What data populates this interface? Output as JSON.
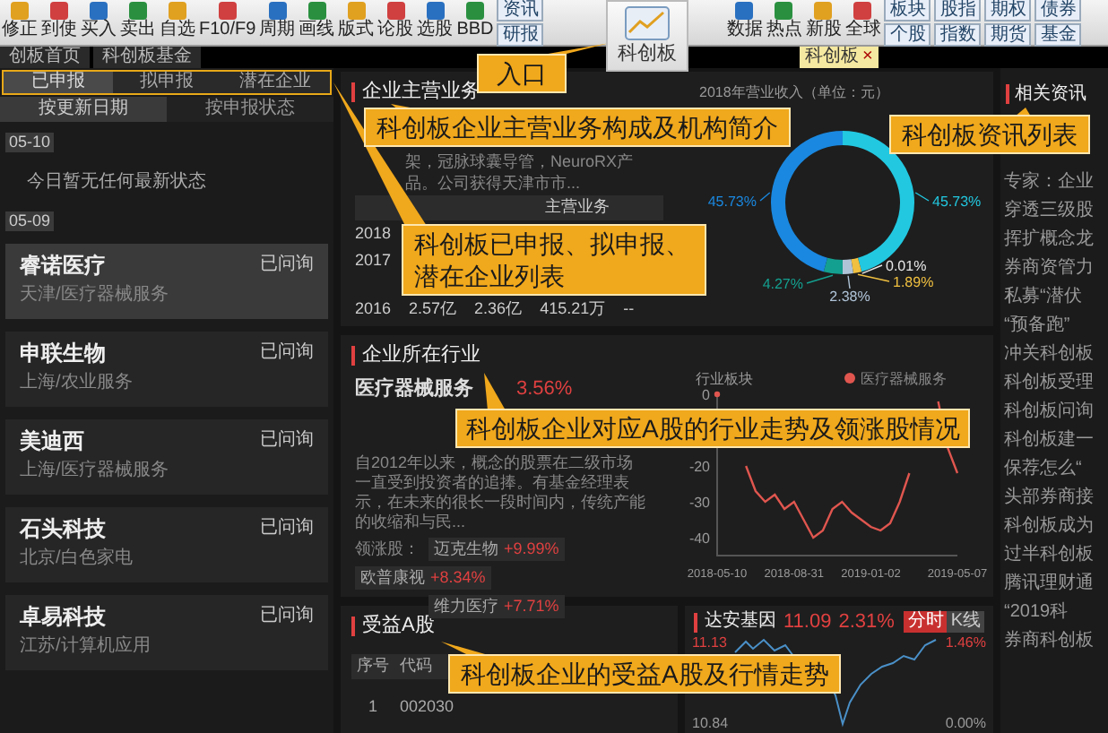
{
  "toolbar": {
    "items": [
      {
        "kind": "tool",
        "label": "修正"
      },
      {
        "kind": "tool",
        "label": "到使"
      },
      {
        "kind": "tool",
        "label": "买入"
      },
      {
        "kind": "tool",
        "label": "卖出"
      },
      {
        "kind": "tool",
        "label": "自选"
      },
      {
        "kind": "tool",
        "label": "F10/F9"
      },
      {
        "kind": "tool",
        "label": "周期"
      },
      {
        "kind": "tool",
        "label": "画线"
      },
      {
        "kind": "tool",
        "label": "版式"
      },
      {
        "kind": "tool",
        "label": "论股"
      },
      {
        "kind": "tool",
        "label": "选股"
      },
      {
        "kind": "tool",
        "label": "BBD"
      },
      {
        "kind": "pair",
        "labels": [
          "资讯",
          "研报"
        ]
      },
      {
        "kind": "gap"
      },
      {
        "kind": "tool",
        "label": "数据"
      },
      {
        "kind": "tool",
        "label": "热点"
      },
      {
        "kind": "tool",
        "label": "新股"
      },
      {
        "kind": "tool",
        "label": "全球"
      },
      {
        "kind": "pair",
        "labels": [
          "板块",
          "个股"
        ]
      },
      {
        "kind": "pair",
        "labels": [
          "股指",
          "指数"
        ]
      },
      {
        "kind": "pair",
        "labels": [
          "期权",
          "期货"
        ]
      },
      {
        "kind": "pair",
        "labels": [
          "债券",
          "基金"
        ]
      }
    ]
  },
  "entry_icon": {
    "label": "科创板"
  },
  "tabs": [
    {
      "label": "创板首页",
      "selected": false
    },
    {
      "label": "科创板基金",
      "selected": false
    }
  ],
  "open_tab": {
    "label": "科创板",
    "close": "×"
  },
  "left": {
    "segments": [
      {
        "label": "已申报",
        "selected": true
      },
      {
        "label": "拟申报",
        "selected": false
      },
      {
        "label": "潜在企业",
        "selected": false
      }
    ],
    "sort_tabs": [
      {
        "label": "按更新日期",
        "selected": true
      },
      {
        "label": "按申报状态",
        "selected": false
      }
    ],
    "groups": [
      {
        "date": "05-10",
        "message": "今日暂无任何最新状态"
      },
      {
        "date": "05-09",
        "companies": [
          {
            "name": "睿诺医疗",
            "info": "天津/医疗器械服务",
            "status": "已问询",
            "selected": true
          },
          {
            "name": "申联生物",
            "info": "上海/农业服务",
            "status": "已问询",
            "selected": false
          },
          {
            "name": "美迪西",
            "info": "上海/医疗器械服务",
            "status": "已问询",
            "selected": false
          },
          {
            "name": "石头科技",
            "info": "北京/白色家电",
            "status": "已问询",
            "selected": false
          },
          {
            "name": "卓易科技",
            "info": "江苏/计算机应用",
            "status": "已问询",
            "selected": false
          }
        ]
      }
    ]
  },
  "business": {
    "title": "企业主营业务",
    "description": "架，冠脉球囊导管，NeuroRX产品。公司获得天津市市...",
    "table": {
      "header": "主营业务",
      "rows": [
        [
          "2018"
        ],
        [
          "2017"
        ],
        [
          "2016",
          "2.57亿",
          "2.36亿",
          "415.21万",
          "--"
        ]
      ]
    },
    "chart_data": {
      "type": "donut",
      "title": "2018年营业收入（单位：元）",
      "values": [
        45.73,
        0.01,
        1.89,
        2.38,
        4.27,
        45.73
      ],
      "value_labels": [
        "45.73%",
        "0.01%",
        "1.89%",
        "2.38%",
        "4.27%",
        "45.73%"
      ]
    }
  },
  "industry": {
    "title": "企业所在行业",
    "name": "医疗器械服务",
    "change": "3.56%",
    "description": "自2012年以来，概念的股票在二级市场一直受到投资者的追捧。有基金经理表示，在未来的很长一段时间内，传统产能的收缩和与民...",
    "leaders_label": "领涨股：",
    "leaders": [
      {
        "name": "迈克生物",
        "change": "+9.99%"
      },
      {
        "name": "欧普康视",
        "change": "+8.34%"
      },
      {
        "name": "维力医疗",
        "change": "+7.71%"
      }
    ],
    "chart_data": {
      "type": "line",
      "title": "行业板块",
      "series": [
        {
          "name": "医疗器械服务",
          "color": "#e0564f",
          "values": [
            0,
            null,
            null,
            -20,
            -27,
            -30,
            -28,
            -32,
            -30,
            -35,
            -40,
            -38,
            -32,
            -30,
            -33,
            -35,
            -37,
            -38,
            -36,
            -30,
            -22,
            null,
            null,
            -2,
            -15,
            -22
          ]
        }
      ],
      "categories": [
        "2018-05-10",
        null,
        null,
        null,
        null,
        null,
        null,
        null,
        "2018-08-31",
        null,
        null,
        null,
        null,
        null,
        null,
        null,
        "2019-01-02",
        null,
        null,
        null,
        null,
        null,
        null,
        null,
        null,
        "2019-05-07"
      ],
      "ylim": [
        -45,
        0
      ],
      "yticks": [
        0,
        -20,
        -30,
        -40
      ]
    }
  },
  "benefit": {
    "title": "受益A股",
    "columns": [
      "序号",
      "代码"
    ],
    "rows": [
      [
        "1",
        "002030"
      ]
    ]
  },
  "quote": {
    "name": "达安基因",
    "price": "11.09",
    "change": "2.31%",
    "modes": [
      {
        "label": "分时",
        "selected": true
      },
      {
        "label": "K线",
        "selected": false
      }
    ],
    "left_axis": [
      "11.13",
      "10.84"
    ],
    "right_axis": [
      "1.46%",
      "0.00%"
    ]
  },
  "news": {
    "title": "相关资讯",
    "items": [
      "专家：企业",
      "穿透三级股",
      "挥扩概念龙",
      "券商资管力",
      "私募“潜伏",
      "“预备跑”",
      "冲关科创板",
      "科创板受理",
      "科创板问询",
      "科创板建一",
      "保荐怎么“",
      "头部券商接",
      "科创板成为",
      "过半科创板",
      "腾讯理财通",
      "“2019科",
      "券商科创板"
    ]
  },
  "callouts": [
    {
      "text": "入口"
    },
    {
      "text": "科创板企业主营业务构成及机构简介"
    },
    {
      "text": "科创板已申报、拟申报、潜在企业列表"
    },
    {
      "text": "科创板资讯列表"
    },
    {
      "text": "科创板企业对应A股的行业走势及领涨股情况"
    },
    {
      "text": "科创板企业的受益A股及行情走势"
    }
  ]
}
